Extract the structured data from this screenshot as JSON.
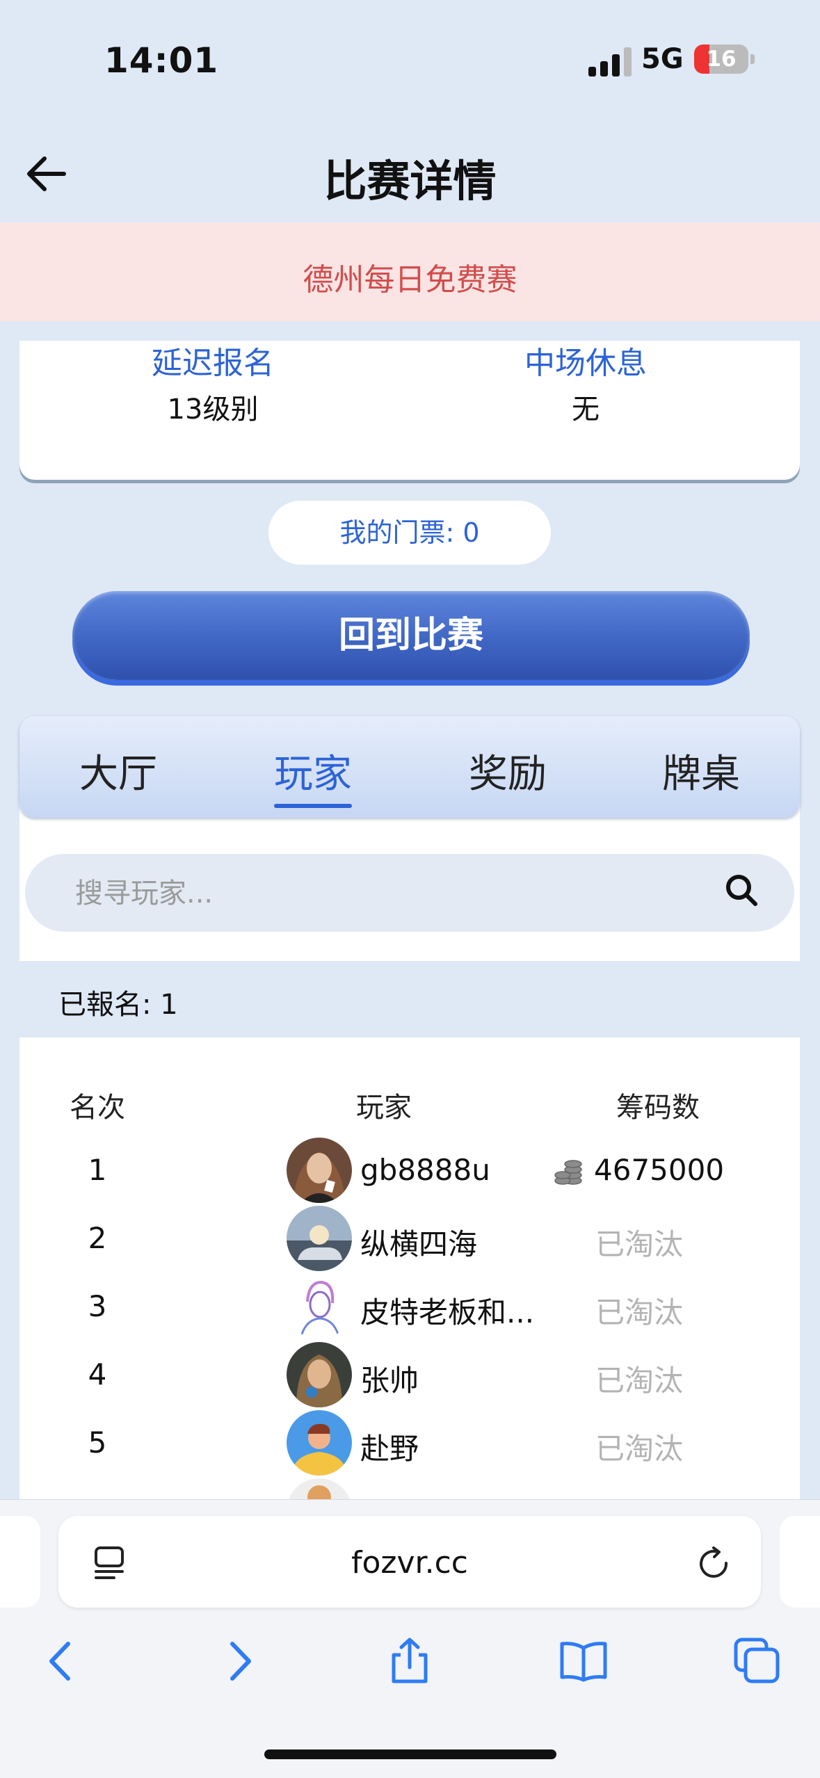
{
  "status": {
    "time": "14:01",
    "network": "5G",
    "battery": "16"
  },
  "header": {
    "title": "比赛详情"
  },
  "banner": {
    "text": "德州每日免费赛"
  },
  "info": {
    "late_reg_label": "延迟报名",
    "late_reg_value": "13级别",
    "break_label": "中场休息",
    "break_value": "无"
  },
  "ticket": {
    "label": "我的门票: 0"
  },
  "main_button": {
    "label": "回到比赛"
  },
  "tabs": [
    {
      "label": "大厅"
    },
    {
      "label": "玩家",
      "active": true
    },
    {
      "label": "奖励"
    },
    {
      "label": "牌桌"
    }
  ],
  "search": {
    "placeholder": "搜寻玩家..."
  },
  "registered": {
    "text": "已報名: 1"
  },
  "table": {
    "headers": {
      "rank": "名次",
      "player": "玩家",
      "chips": "筹码数"
    },
    "rows": [
      {
        "rank": "1",
        "name": "gb8888u",
        "chips": "4675000"
      },
      {
        "rank": "2",
        "name": "纵横四海",
        "status": "已淘汰"
      },
      {
        "rank": "3",
        "name": "皮特老板和...",
        "status": "已淘汰"
      },
      {
        "rank": "4",
        "name": "张帅",
        "status": "已淘汰"
      },
      {
        "rank": "5",
        "name": "赴野",
        "status": "已淘汰"
      }
    ]
  },
  "browser": {
    "url": "fozvr.cc"
  },
  "colors": {
    "accent": "#2c63d6",
    "banner_bg": "#fbe4e4",
    "banner_text": "#d24c4c",
    "eliminated": "#b3b3b3"
  }
}
